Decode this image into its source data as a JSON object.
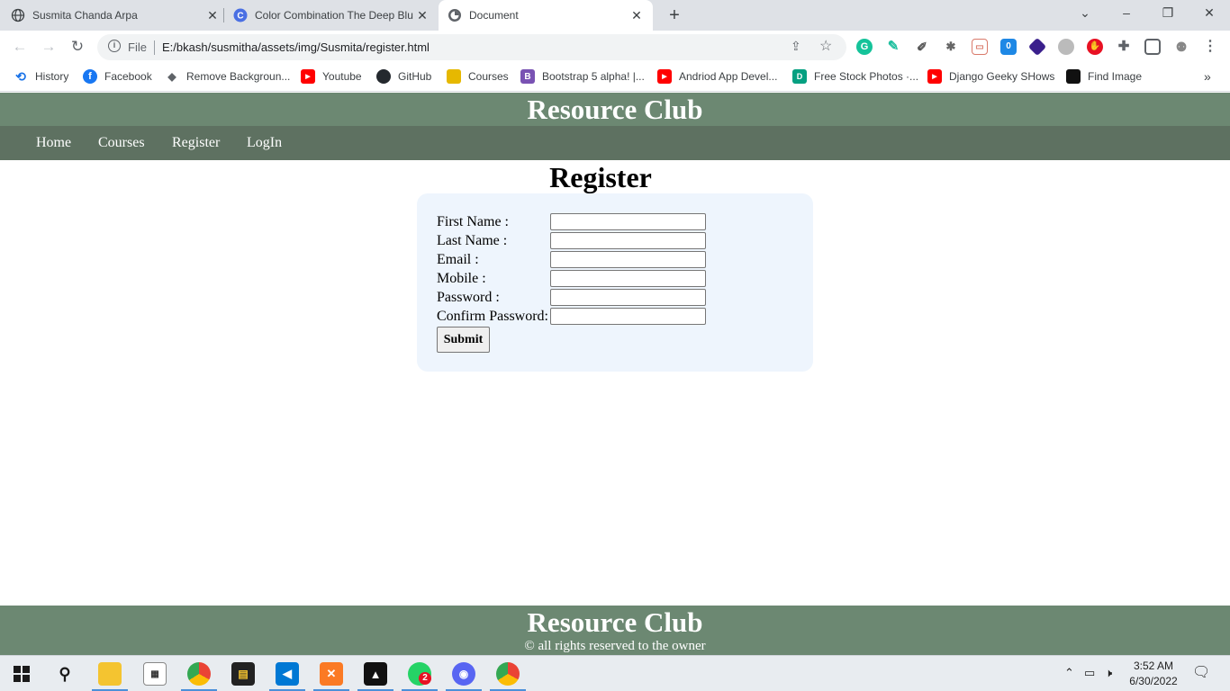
{
  "browser": {
    "tabs": [
      {
        "title": "Susmita Chanda Arpa",
        "icon": "globe-icon",
        "active": false
      },
      {
        "title": "Color Combination The Deep Blu",
        "icon": "c-icon",
        "active": false
      },
      {
        "title": "Document",
        "icon": "globe-icon",
        "active": true
      }
    ],
    "address": {
      "scheme_label": "File",
      "url": "E:/bkash/susmitha/assets/img/Susmita/register.html"
    },
    "bookmarks": [
      {
        "label": "History",
        "icon": "history-icon",
        "color": "#1a73e8"
      },
      {
        "label": "Facebook",
        "icon": "facebook-icon",
        "color": "#1877f2"
      },
      {
        "label": "Remove Backgroun...",
        "icon": "layers-icon",
        "color": "#5f6368"
      },
      {
        "label": "Youtube",
        "icon": "youtube-icon",
        "color": "#ff0000"
      },
      {
        "label": "GitHub",
        "icon": "github-icon",
        "color": "#24292e"
      },
      {
        "label": "Courses",
        "icon": "courses-icon",
        "color": "#e6b800"
      },
      {
        "label": "Bootstrap 5 alpha! |...",
        "icon": "bootstrap-icon",
        "color": "#7952b3"
      },
      {
        "label": "Andriod App Devel...",
        "icon": "youtube-icon",
        "color": "#ff0000"
      },
      {
        "label": "Free Stock Photos ·...",
        "icon": "stock-icon",
        "color": "#05a081"
      },
      {
        "label": "Django Geeky SHows",
        "icon": "youtube-icon",
        "color": "#ff0000"
      },
      {
        "label": "Find Image",
        "icon": "unsplash-icon",
        "color": "#111111"
      }
    ],
    "more_bookmarks": "»"
  },
  "site": {
    "title": "Resource Club",
    "nav": [
      "Home",
      "Courses",
      "Register",
      "LogIn"
    ],
    "colors": {
      "header": "#6c8872",
      "nav": "#5e7161",
      "card": "#eef5fd"
    }
  },
  "form": {
    "heading": "Register",
    "fields": [
      {
        "label": "First Name :",
        "value": ""
      },
      {
        "label": "Last Name :",
        "value": ""
      },
      {
        "label": "Email :",
        "value": ""
      },
      {
        "label": "Mobile :",
        "value": ""
      },
      {
        "label": "Password :",
        "value": ""
      },
      {
        "label": "Confirm Password:",
        "value": ""
      }
    ],
    "submit_label": "Submit"
  },
  "footer": {
    "title": "Resource Club",
    "copyright": "© all rights reserved to the owner"
  },
  "taskbar": {
    "time": "3:52 AM",
    "date": "6/30/2022",
    "whatsapp_badge": "2"
  }
}
